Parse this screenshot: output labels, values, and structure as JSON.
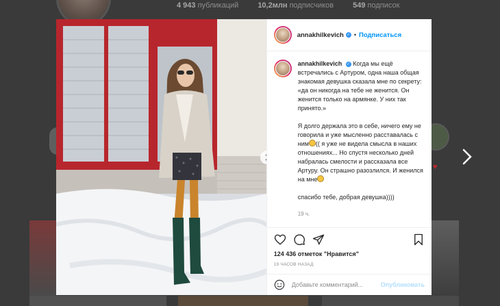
{
  "profile": {
    "stats": [
      {
        "count": "4 943",
        "label": "публикаций"
      },
      {
        "count": "10,2млн",
        "label": "подписчиков"
      },
      {
        "count": "549",
        "label": "подписок"
      }
    ]
  },
  "post": {
    "username": "annakhilkevich",
    "separator": "•",
    "follow_label": "Подписаться",
    "caption": {
      "username": "annakhilkevich",
      "para1": "Когда мы ещё встречались с Артуром, одна наша общая знакомая девушка сказала мне по секрету: «да он никогда на тебе не женится. Он женится только на армянке. У них так принято.»",
      "para2a": "Я долго держала это в себе, ничего ему не говорила и уже мысленно расставалась с ним",
      "para2b": "(( я уже не видела смысла в наших отношениях... Но спустя несколько дней набралась смелости и рассказала все Артуру. Он страшно разозлился. И женился на мне",
      "para3": "спасибо тебе, добрая девушка))))",
      "time": "19 ч."
    },
    "likes_count": "124 436",
    "likes_text": "отметок \"Нравится\"",
    "posted_ago": "19 ЧАСОВ НАЗАД",
    "comment_placeholder": "Добавьте комментарий...",
    "publish_label": "Опубликовать"
  },
  "icons": {
    "like": "heart-icon",
    "comment": "comment-icon",
    "share": "share-icon",
    "save": "bookmark-icon",
    "emoji": "smiley-icon",
    "next": "chevron-right-icon"
  },
  "colors": {
    "link": "#0095f6",
    "publish_disabled": "#b2dffc",
    "verified": "#3897f0"
  }
}
